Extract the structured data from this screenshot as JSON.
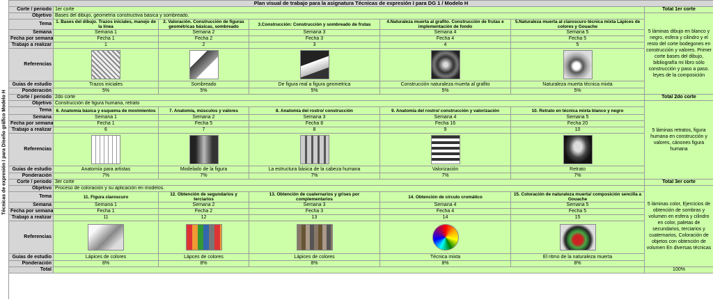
{
  "sidebar_label": "Técnicas de expresión I para Diseño gráfico Modelo H",
  "title": "Plan visual de trabajo para la asignatura Técnicas de expresión I para DG 1 / Modelo H",
  "row_labels": {
    "corte": "Corte / periodo",
    "objetivo": "Objetivo",
    "tema": "Tema",
    "semana": "Semana",
    "fecha": "Fecha por semanas",
    "trabajo": "Trabajo a realizar",
    "referencias": "Referencias",
    "guias": "Guias de estudio",
    "ponderacion": "Ponderación",
    "total": "Total"
  },
  "sections": [
    {
      "corte": "1er corte",
      "total_header": "Total 1er corte",
      "objetivo": "Bases del dibujo, geometría constructiva básica y sombreado.",
      "temas": [
        "1. Bases del dibujo. Trazos iniciales, manejo de la línea",
        "2. Valoración. Construcción de figuras geométricas básicas, sombreado",
        "3.Construcción: Construcción y sombreado de frutas",
        "4.Naturaleza muerta al grafito. Construcción de frutas e implementación de fondo",
        "5.Naturaleza muerta al claroscuro técnica mixta Lápices de colores y Gouache"
      ],
      "semanas": [
        "Semana 1",
        "Semana 2",
        "Semana 3",
        "Semana 4",
        "Semana 5"
      ],
      "fechas": [
        "Fecha 1",
        "Fecha 2",
        "Fecha 3",
        "Fecha 4",
        "Fecha 5"
      ],
      "trabajos": [
        "1",
        "2",
        "3",
        "4",
        "5"
      ],
      "referencias": [
        "hand-sketch-thumbnail",
        "box-shading-thumbnail",
        "fruit-construction-thumbnail",
        "graphite-still-life-thumbnail",
        "mixed-technique-still-life-thumbnail"
      ],
      "guias": [
        "Trazos iniciales",
        "Sombreado",
        "De figura real a figura geometrica",
        "Construcción naturaleza muerta al grafito",
        "Naturaleza muerta técnica mixta"
      ],
      "ponderaciones": [
        "5%",
        "5%",
        "5%",
        "5%",
        "5%"
      ],
      "resumen": "5 láminas dibujo en blanco y negro, esfera y cilindro y el resto del corte bodegones en construcción y valores. Primer corte bases del dibujo, bibliografía mi libro sólo construcción y paso a paso. leyes de la composición",
      "total_pct": "25%"
    },
    {
      "corte": "2do corte",
      "total_header": "Total 2do corte",
      "objetivo": "Construcción de figura humana, retrato",
      "temas": [
        "6. Anatomía básica y esquema de movimientos",
        "7. Anatomía, músculos y valores",
        "8. Anatomía del rostro/ construcción",
        "9. Anatomía del rostro/ construcción y valorización",
        "10. Retrato en técnica mixta blanco y negro"
      ],
      "semanas": [
        "Semana 1",
        "Semana  2",
        "Semana 3",
        "Semana 4",
        "Semana 5"
      ],
      "fechas": [
        "Fecha 1",
        "Fecha 5",
        "Fecha 8",
        "Fecha 16",
        "Fecha 20"
      ],
      "trabajos": [
        "6",
        "7",
        "8",
        "9",
        "10"
      ],
      "referencias": [
        "anatomy-sketch-thumbnail",
        "hands-drawing-thumbnail",
        "faces-thumbnail",
        "face-studies-thumbnail",
        "portrait-thumbnail"
      ],
      "guias": [
        "Anatomía para artistas",
        "Modelado de la figura",
        "La estructura básica de la cabeza humana",
        "Valorización",
        "Retrato"
      ],
      "ponderaciones": [
        "7%",
        "7%",
        "7%",
        "7%",
        "7%"
      ],
      "resumen": "5 láminas retratos, figura humana en construcción y valores, cánones figura humana",
      "total_pct": "35%"
    },
    {
      "corte": "3er corte",
      "total_header": "Total 3er corte",
      "objetivo": "Proceso de coloración y su aplicación en modelos.",
      "temas": [
        "11. Figura claroscuro",
        "12. Obtención de segundarios y terciarios",
        "13. Obtención de cuaternarios y grises por complementarios",
        "14. Obtención de círculo cromático",
        "15. Coloración de naturaleza muerta/ composición sencilla a Gouache"
      ],
      "semanas": [
        "Semana 1",
        "Semana 2",
        "Semana 3",
        "Semana 4",
        "Semana 5"
      ],
      "fechas": [
        "Fecha 1",
        "Fecha 2",
        "Fecha 3",
        "Fecha 4",
        "Fecha 5"
      ],
      "trabajos": [
        "11",
        "12",
        "13",
        "14",
        "15"
      ],
      "referencias": [
        "cone-thumbnail",
        "secondary-colors-thumbnail",
        "quaternary-colors-thumbnail",
        "color-wheel-thumbnail",
        "watermelon-still-life-thumbnail"
      ],
      "guias": [
        "Lápices de colores",
        "Lápces de colores",
        "Lápices de colores",
        "Técnica mixta",
        "El ritmo de la naturaleza muerta"
      ],
      "ponderaciones": [
        "8%",
        "8%",
        "8%",
        "8%",
        "8%"
      ],
      "resumen": "5 láminas color, Ejercicios de obtención de sombras y volumen en esfera y cilindro en color, paletas de secundarios, terciarios y cuaternarios, Coloración de objetos con obtención de volumen En diversas técnicas",
      "total_pct": "40%"
    }
  ],
  "grand_total": "100%",
  "colors": {
    "green": "#ccffa8",
    "dark_green": "#b3f07f",
    "grey": "#d6d6d6"
  }
}
